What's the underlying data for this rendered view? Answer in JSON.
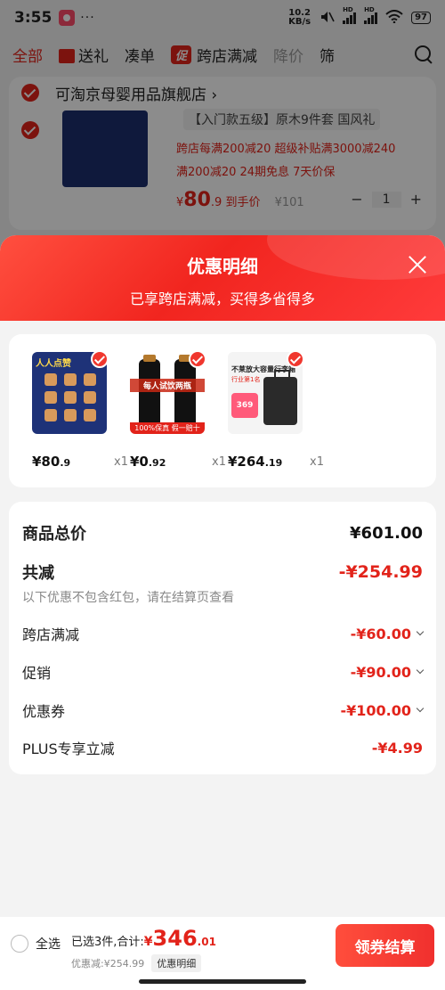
{
  "status_bar": {
    "time": "3:55",
    "dots": "···",
    "net_speed_value": "10.2",
    "net_speed_unit": "KB/s",
    "hd1": "HD",
    "hd2": "HD",
    "battery": "97"
  },
  "filter_bar": {
    "items": [
      {
        "label": "全部",
        "state": "active"
      },
      {
        "label": "送礼",
        "icon": "gift-icon"
      },
      {
        "label": "凑单"
      },
      {
        "label": "跨店满减",
        "tag": "促"
      },
      {
        "label": "降价",
        "state": "muted"
      },
      {
        "label": "筛"
      }
    ]
  },
  "cart_item": {
    "shop_name": "可淘京母婴用品旗舰店",
    "title": "【入门款五级】原木9件套 国风礼",
    "promo_line1": "跨店每满200减20  超级补贴满3000减240",
    "promo_line2": "满200减20  24期免息  7天价保",
    "price_symbol": "¥",
    "price_int": "80",
    "price_dec": ".9",
    "price_label": "到手价",
    "original_price": "¥101",
    "quantity": "1",
    "minus": "−",
    "plus": "+"
  },
  "sheet": {
    "title": "优惠明细",
    "subtitle": "已享跨店满减，买得多省得多",
    "products": [
      {
        "price_int": "¥80",
        "price_dec": ".9",
        "qty": "x1",
        "image": "wooden-puzzle-set",
        "image_title": "人人点赞"
      },
      {
        "price_int": "¥0",
        "price_dec": ".92",
        "qty": "x1",
        "image": "liquor-bottles",
        "image_banner": "每人试饮两瓶",
        "image_foot": "100%保真  假一赔十"
      },
      {
        "price_int": "¥264",
        "price_dec": ".19",
        "qty": "x1",
        "image": "suitcase",
        "image_text": "不莱放大容量行李箱",
        "image_rank": "行业第1名",
        "image_badge": "369"
      }
    ],
    "summary": {
      "total_label": "商品总价",
      "total_value": "¥601.00",
      "reduction_label": "共减",
      "reduction_value": "-¥254.99",
      "note": "以下优惠不包含红包，请在结算页查看",
      "lines": [
        {
          "label": "跨店满减",
          "value": "-¥60.00",
          "expandable": true
        },
        {
          "label": "促销",
          "value": "-¥90.00",
          "expandable": true
        },
        {
          "label": "优惠券",
          "value": "-¥100.00",
          "expandable": true
        },
        {
          "label": "PLUS专享立减",
          "value": "-¥4.99",
          "expandable": false
        }
      ]
    }
  },
  "bottom_bar": {
    "select_all_label": "全选",
    "selected_prefix": "已选3件,合计:",
    "total_symbol": "¥",
    "total_int": "346",
    "total_dec": ".01",
    "discount_text": "优惠减:¥254.99",
    "detail_chip": "优惠明细",
    "checkout_label": "领券结算"
  },
  "colors": {
    "accent": "#e2231a",
    "header_gradient_start": "#ff4f3f",
    "header_gradient_end": "#ff3b3b",
    "checkout_button": "#f0302e"
  }
}
